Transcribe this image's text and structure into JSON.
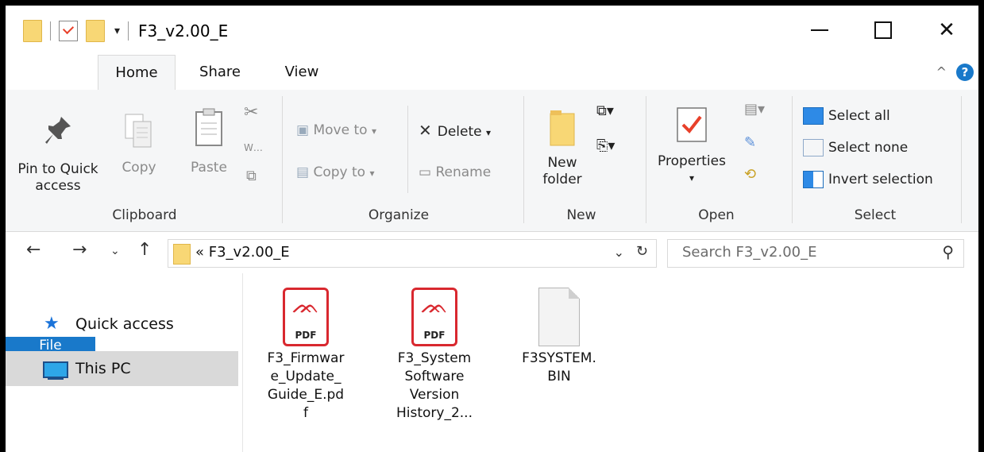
{
  "window": {
    "title": "F3_v2.00_E",
    "minimize": "—",
    "maximize": "☐",
    "close": "✕"
  },
  "tabs": [
    {
      "label": "File"
    },
    {
      "label": "Home"
    },
    {
      "label": "Share"
    },
    {
      "label": "View"
    }
  ],
  "ribbon": {
    "clipboard": {
      "label": "Clipboard",
      "pin_line1": "Pin to Quick",
      "pin_line2": "access",
      "copy": "Copy",
      "paste": "Paste"
    },
    "organize": {
      "label": "Organize",
      "move_to": "Move to",
      "copy_to": "Copy to",
      "delete": "Delete",
      "rename": "Rename"
    },
    "new": {
      "label": "New",
      "new_folder_line1": "New",
      "new_folder_line2": "folder"
    },
    "open": {
      "label": "Open",
      "properties": "Properties"
    },
    "select": {
      "label": "Select",
      "select_all": "Select all",
      "select_none": "Select none",
      "invert_selection": "Invert selection"
    }
  },
  "address": {
    "path": "« F3_v2.00_E",
    "search_placeholder": "Search F3_v2.00_E"
  },
  "nav_pane": {
    "items": [
      {
        "label": "Quick access",
        "icon": "star-icon"
      },
      {
        "label": "This PC",
        "icon": "computer-icon",
        "selected": true
      }
    ]
  },
  "files": [
    {
      "name_lines": [
        "F3_Firmwar",
        "e_Update_",
        "Guide_E.pd",
        "f"
      ],
      "type": "pdf",
      "badge": "PDF"
    },
    {
      "name_lines": [
        "F3_System",
        "Software",
        "Version",
        "History_2..."
      ],
      "type": "pdf",
      "badge": "PDF"
    },
    {
      "name_lines": [
        "F3SYSTEM.",
        "BIN"
      ],
      "type": "generic"
    }
  ],
  "colors": {
    "accent": "#1979ca",
    "pdf_red": "#d9282f",
    "folder_yellow": "#f8d775"
  }
}
